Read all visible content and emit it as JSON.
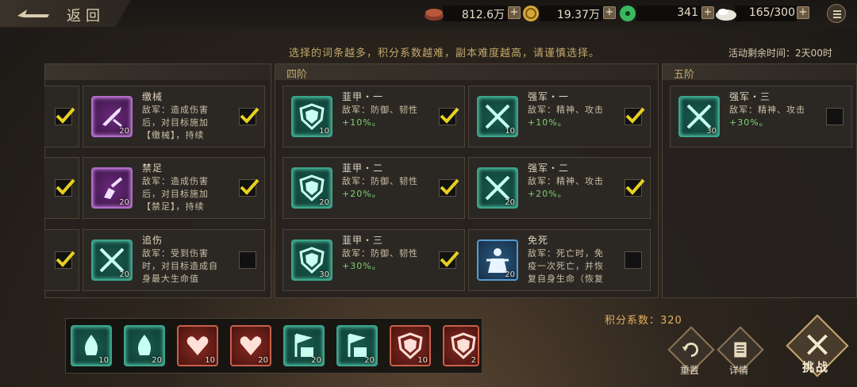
{
  "topbar": {
    "back_label": "返回",
    "resources": [
      {
        "icon": "copper-coin-icon",
        "value": "812.6万"
      },
      {
        "icon": "gold-coin-icon",
        "value": "19.37万"
      },
      {
        "icon": "jade-icon",
        "value": "341"
      },
      {
        "icon": "stamina-icon",
        "value": "165/300"
      }
    ]
  },
  "hint": "选择的词条越多，积分系数越难，副本难度越高，请谨慎选择。",
  "timer": "活动剩余时间：2天00时",
  "tiers": [
    {
      "title": "",
      "cards": [
        {
          "title": "缴械",
          "desc": "敌军：造成伤害\n后，对目标施加\n【缴械】，持续",
          "level": "20",
          "checked": true,
          "icon": "disarm-icon",
          "color": "purple",
          "stub_checked": true
        },
        {
          "title": "禁足",
          "desc": "敌军：造成伤害\n后，对目标施加\n【禁足】，持续",
          "level": "20",
          "checked": true,
          "icon": "immobilize-icon",
          "color": "purple",
          "stub_checked": true
        },
        {
          "title": "追伤",
          "desc": "敌军：受到伤害\n时，对目标造成自\n身最大生命值",
          "level": "20",
          "checked": false,
          "icon": "crossed-swords-icon",
          "color": "green",
          "stub_checked": true
        }
      ]
    },
    {
      "title": "四阶",
      "cards": [
        {
          "title": "韮甲・一",
          "desc_main": "敌军：防御、韧性",
          "bonus": "+10%。",
          "level": "10",
          "checked": true,
          "icon": "shield-icon",
          "color": "green"
        },
        {
          "title": "强军・一",
          "desc_main": "敌军：精神、攻击",
          "bonus": "+10%。",
          "level": "10",
          "checked": true,
          "icon": "crossed-swords-icon",
          "color": "green"
        },
        {
          "title": "韮甲・二",
          "desc_main": "敌军：防御、韧性",
          "bonus": "+20%。",
          "level": "20",
          "checked": true,
          "icon": "shield-icon",
          "color": "green"
        },
        {
          "title": "强军・二",
          "desc_main": "敌军：精神、攻击",
          "bonus": "+20%。",
          "level": "20",
          "checked": true,
          "icon": "crossed-swords-icon",
          "color": "green"
        },
        {
          "title": "韮甲・三",
          "desc_main": "敌军：防御、韧性",
          "bonus": "+30%。",
          "level": "30",
          "checked": true,
          "icon": "shield-icon",
          "color": "green"
        },
        {
          "title": "免死",
          "desc": "敌军：死亡时，免\n疫一次死亡，并恢\n复自身生命（恢复",
          "level": "20",
          "checked": false,
          "icon": "warrior-icon",
          "color": "blue"
        }
      ]
    },
    {
      "title": "五阶",
      "cards": [
        {
          "title": "强军・三",
          "desc_main": "敌军：精神、攻击",
          "bonus": "+30%。",
          "level": "30",
          "checked": false,
          "icon": "crossed-swords-icon",
          "color": "green"
        }
      ]
    }
  ],
  "selected": [
    {
      "icon": "flame-warrior-icon",
      "color": "green",
      "level": "10"
    },
    {
      "icon": "flame-warrior-icon",
      "color": "green",
      "level": "20"
    },
    {
      "icon": "heart-icon",
      "color": "red",
      "level": "10"
    },
    {
      "icon": "heart-icon",
      "color": "red",
      "level": "20"
    },
    {
      "icon": "banner-troops-icon",
      "color": "green",
      "level": "20"
    },
    {
      "icon": "banner-troops-icon",
      "color": "green",
      "level": "20"
    },
    {
      "icon": "shield-icon",
      "color": "red",
      "level": "10"
    },
    {
      "icon": "shield-icon",
      "color": "red",
      "level": "2"
    }
  ],
  "score": {
    "label": "积分系数：",
    "value": "320"
  },
  "actions": {
    "reset": "重置",
    "details": "详情",
    "challenge": "挑战"
  }
}
